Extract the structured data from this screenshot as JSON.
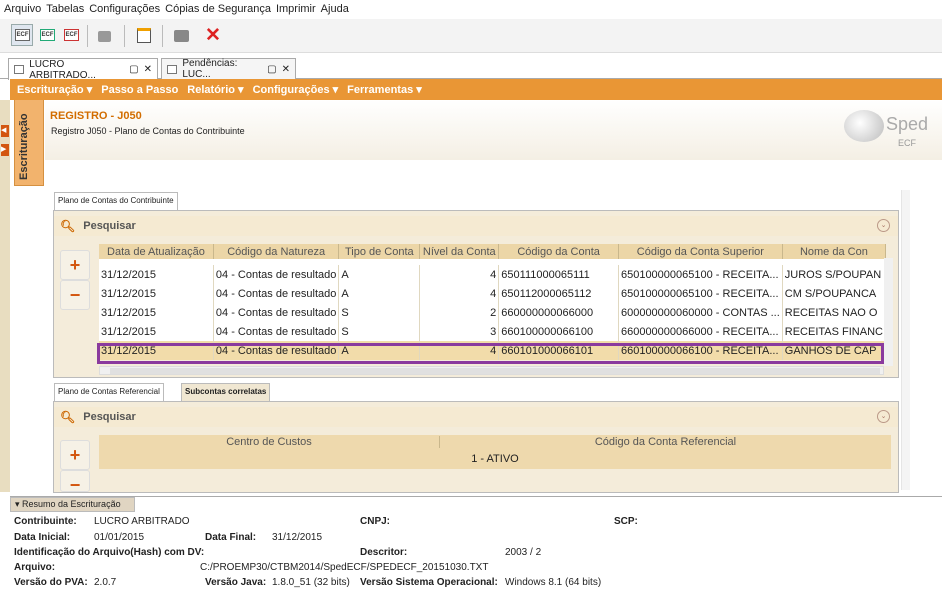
{
  "menu": [
    "Arquivo",
    "Tabelas",
    "Configurações",
    "Cópias de Segurança",
    "Imprimir",
    "Ajuda"
  ],
  "toolbar": {
    "ecf_label": "ECF",
    "delete_icon": "x-icon"
  },
  "tabs": [
    {
      "label": "LUCRO ARBITRADO..."
    },
    {
      "label": "Pendências: LUC..."
    }
  ],
  "nav": [
    "Escrituração ▾",
    "Passo a Passo",
    "Relatório ▾",
    "Configurações ▾",
    "Ferramentas ▾"
  ],
  "sidebar": {
    "vertical_tab": "Escrituração"
  },
  "header": {
    "title": "REGISTRO - J050",
    "subtitle": "Registro J050 - Plano de Contas do Contribuinte",
    "logo": "Sped",
    "logo_sub": "ECF"
  },
  "panel1": {
    "tab": "Plano de Contas do Contribuinte",
    "search": "Pesquisar",
    "plus": "+",
    "minus": "−",
    "columns": [
      "Data de Atualização",
      "Código da Natureza",
      "Tipo de Conta",
      "Nível da Conta",
      "Código da Conta",
      "Código da Conta Superior",
      "Nome da Con"
    ],
    "rows": [
      [
        "31/12/2015",
        "04 - Contas de resultado",
        "A",
        "4",
        "650111000065111",
        "650100000065100 - RECEITA...",
        "JUROS S/POUPAN"
      ],
      [
        "31/12/2015",
        "04 - Contas de resultado",
        "A",
        "4",
        "650112000065112",
        "650100000065100 - RECEITA...",
        "CM S/POUPANCA"
      ],
      [
        "31/12/2015",
        "04 - Contas de resultado",
        "S",
        "2",
        "660000000066000",
        "600000000060000 - CONTAS ...",
        "RECEITAS NAO O"
      ],
      [
        "31/12/2015",
        "04 - Contas de resultado",
        "S",
        "3",
        "660100000066100",
        "660000000066000 - RECEITA...",
        "RECEITAS FINANC"
      ],
      [
        "31/12/2015",
        "04 - Contas de resultado",
        "A",
        "4",
        "660101000066101",
        "660100000066100 - RECEITA...",
        "GANHOS DE CAP"
      ]
    ]
  },
  "panel2": {
    "tabs": [
      "Plano de Contas Referencial",
      "Subcontas correlatas"
    ],
    "search": "Pesquisar",
    "plus": "+",
    "minus": "−",
    "columns": [
      "Centro de Custos",
      "Código da Conta Referencial"
    ],
    "value": "1 - ATIVO"
  },
  "resumo": {
    "title": "Resumo da Escrituração",
    "contribuinte_l": "Contribuinte:",
    "contribuinte": "LUCRO ARBITRADO",
    "cnpj_l": "CNPJ:",
    "scp_l": "SCP:",
    "data_ini_l": "Data Inicial:",
    "data_ini": "01/01/2015",
    "data_fim_l": "Data Final:",
    "data_fim": "31/12/2015",
    "hash_l": "Identificação do Arquivo(Hash) com DV:",
    "descritor_l": "Descritor:",
    "descritor": "2003 / 2",
    "arquivo_l": "Arquivo:",
    "arquivo": "C:/PROEMP30/CTBM2014/SpedECF/SPEDECF_20151030.TXT",
    "pva_l": "Versão do PVA:",
    "pva": "2.0.7",
    "java_l": "Versão Java:",
    "java": "1.8.0_51 (32 bits)",
    "so_l": "Versão Sistema Operacional:",
    "so": "Windows 8.1 (64 bits)"
  }
}
